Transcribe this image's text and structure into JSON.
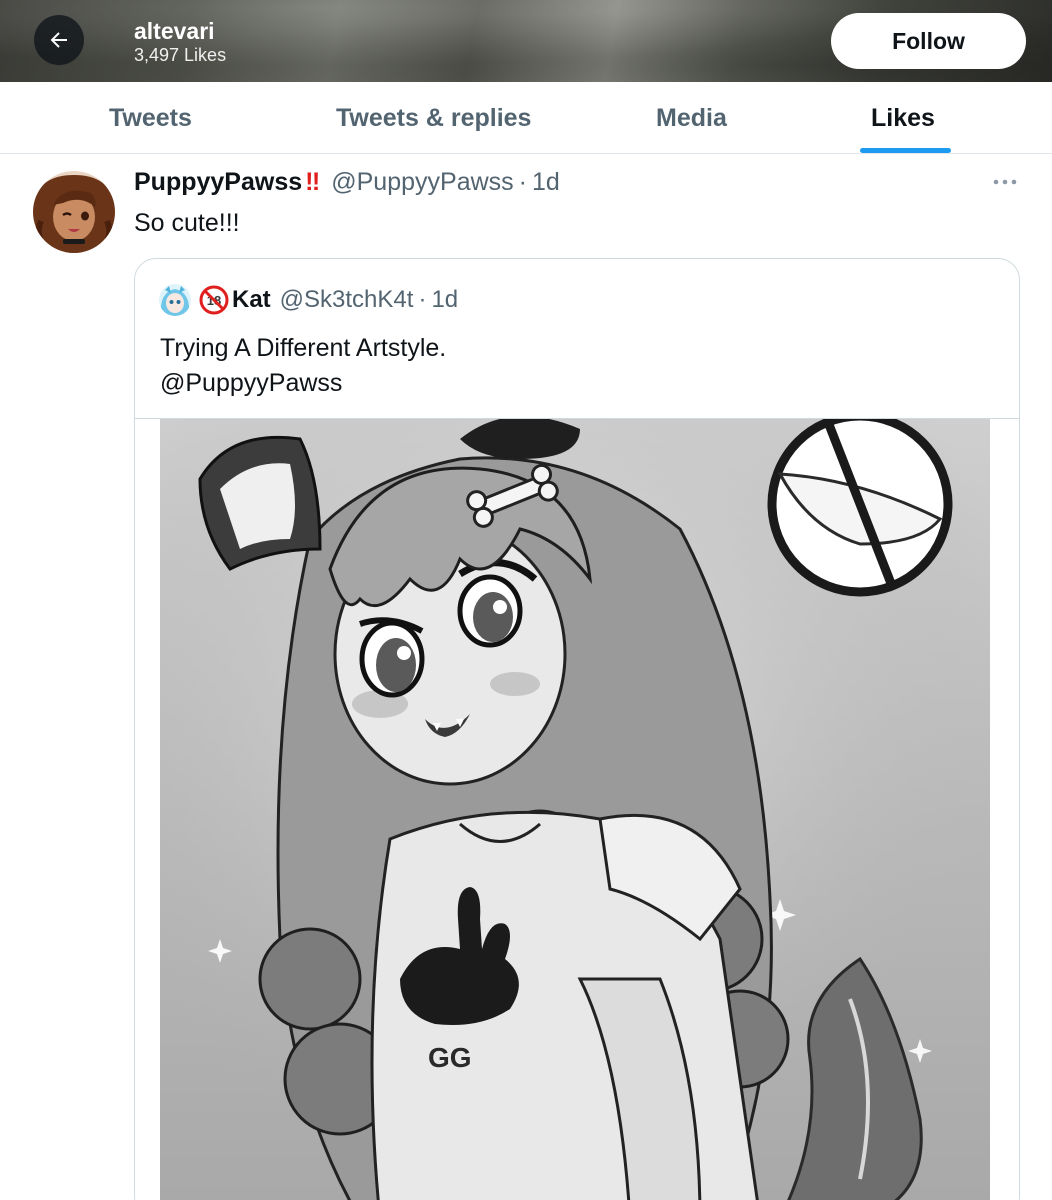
{
  "header": {
    "profile_name": "altevari",
    "likes_count": "3,497 Likes",
    "follow_label": "Follow"
  },
  "tabs": [
    {
      "label": "Tweets",
      "active": false
    },
    {
      "label": "Tweets & replies",
      "active": false
    },
    {
      "label": "Media",
      "active": false
    },
    {
      "label": "Likes",
      "active": true
    }
  ],
  "tweet": {
    "display_name": "PuppyyPawss",
    "name_emoji": "‼",
    "handle": "@PuppyyPawss",
    "separator": "·",
    "time": "1d",
    "text": "So cute!!!",
    "quote": {
      "display_name": "Kat",
      "badge_text": "18",
      "handle": "@Sk3tchK4t",
      "separator": "·",
      "time": "1d",
      "text": "Trying A Different Artstyle.\n@PuppyyPawss",
      "image_shirt_text": "GG"
    }
  },
  "colors": {
    "accent": "#1d9bf0",
    "text_primary": "#0f1419",
    "text_secondary": "#536471",
    "border": "#cfd9de"
  },
  "icons": {
    "back": "arrow-left-icon",
    "more": "more-horizontal-icon",
    "no_sign": "prohibited-sign-icon"
  }
}
